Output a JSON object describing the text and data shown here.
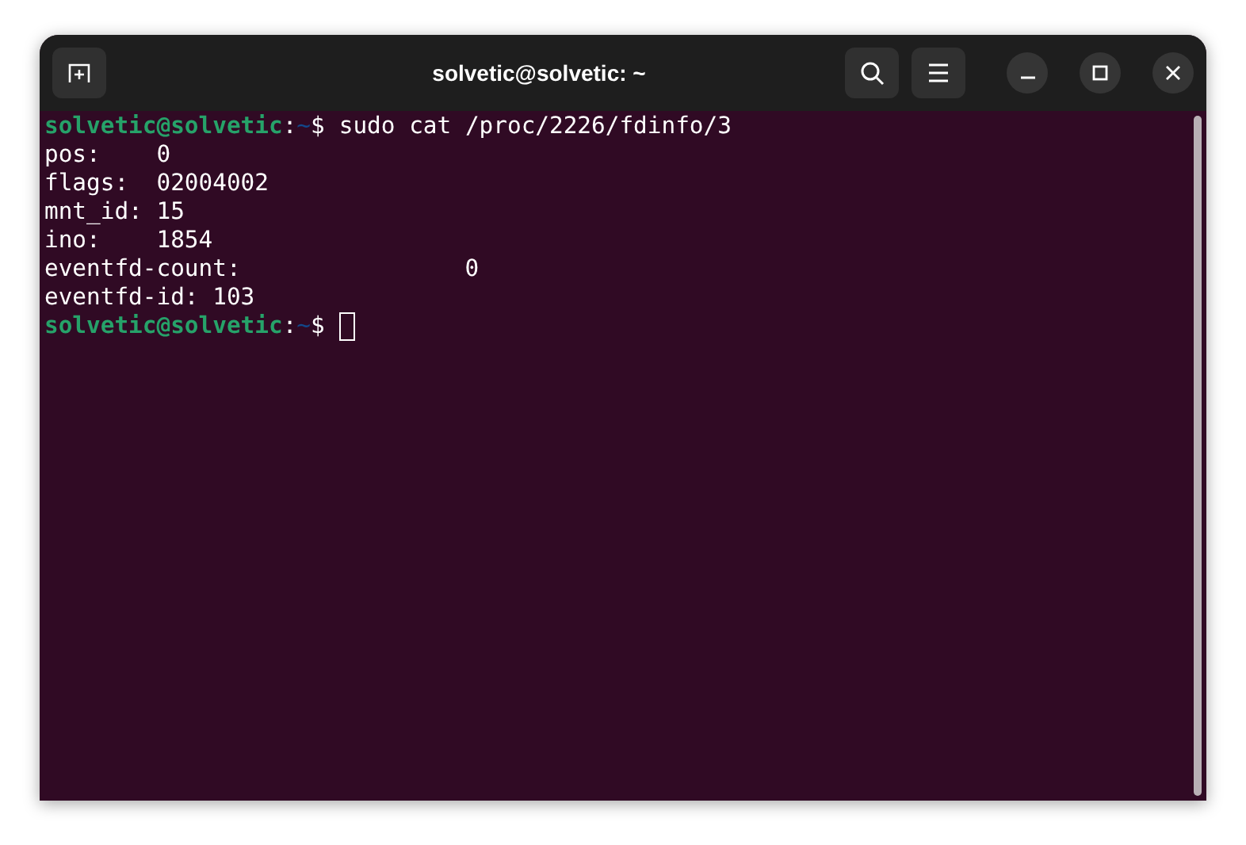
{
  "window": {
    "title": "solvetic@solvetic: ~"
  },
  "terminal": {
    "lines": [
      {
        "kind": "prompt",
        "user": "solvetic@solvetic",
        "separator": ":",
        "path": "~",
        "symbol": "$",
        "command": "sudo cat /proc/2226/fdinfo/3",
        "cursor": false
      },
      {
        "kind": "output",
        "text": "pos:    0"
      },
      {
        "kind": "output",
        "text": "flags:  02004002"
      },
      {
        "kind": "output",
        "text": "mnt_id: 15"
      },
      {
        "kind": "output",
        "text": "ino:    1854"
      },
      {
        "kind": "output",
        "text": "eventfd-count:                0"
      },
      {
        "kind": "output",
        "text": "eventfd-id: 103"
      },
      {
        "kind": "prompt",
        "user": "solvetic@solvetic",
        "separator": ":",
        "path": "~",
        "symbol": "$",
        "cursor": true
      }
    ]
  }
}
